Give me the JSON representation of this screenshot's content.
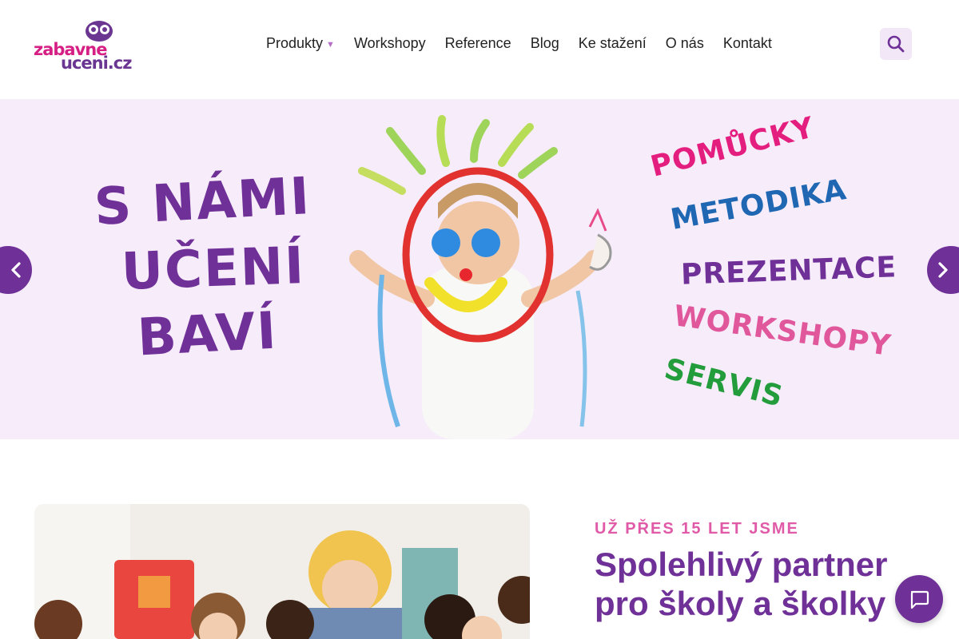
{
  "header": {
    "logo": {
      "line1": "zabavne",
      "line2": "uceni.cz"
    },
    "nav": [
      {
        "label": "Produkty",
        "has_dropdown": true
      },
      {
        "label": "Workshopy"
      },
      {
        "label": "Reference"
      },
      {
        "label": "Blog"
      },
      {
        "label": "Ke stažení"
      },
      {
        "label": "O nás"
      },
      {
        "label": "Kontakt"
      }
    ],
    "search_icon": "search-icon"
  },
  "hero": {
    "headline_lines": [
      "S NÁMI",
      "UČENÍ",
      "BAVÍ"
    ],
    "keywords": [
      "POMŮCKY",
      "METODIKA",
      "PREZENTACE",
      "WORKSHOPY",
      "SERVIS"
    ],
    "prev_icon": "chevron-left-icon",
    "next_icon": "chevron-right-icon"
  },
  "about": {
    "eyebrow": "UŽ PŘES 15 LET JSME",
    "headline": "Spolehlivý partner pro školy a školky"
  },
  "chat": {
    "icon": "chat-bubble-icon"
  },
  "colors": {
    "brand_purple": "#6f3197",
    "brand_pink": "#e41e7f",
    "hero_bg": "#f6ecfa",
    "eyebrow_pink": "#e05aa8"
  }
}
